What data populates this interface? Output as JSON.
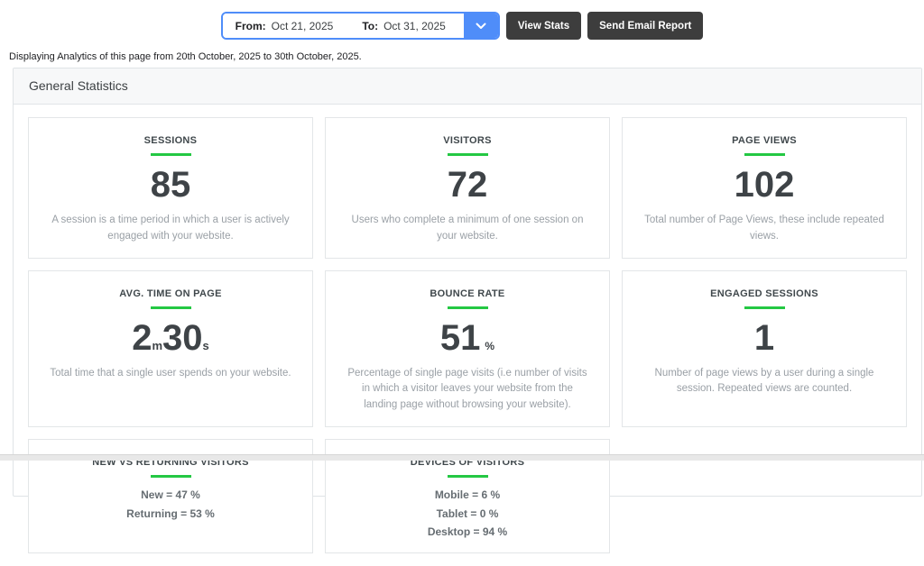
{
  "toolbar": {
    "from_label": "From:",
    "from_value": "Oct 21, 2025",
    "to_label": "To:",
    "to_value": "Oct 31, 2025",
    "view_stats_label": "View Stats",
    "send_email_label": "Send Email Report"
  },
  "subtitle": "Displaying Analytics of this page from 20th October, 2025 to 30th October, 2025.",
  "panel": {
    "title": "General Statistics"
  },
  "cards": [
    {
      "title": "SESSIONS",
      "value": "85",
      "description": "A session is a time period in which a user is actively engaged with your website."
    },
    {
      "title": "VISITORS",
      "value": "72",
      "description": "Users who complete a minimum of one session on your website."
    },
    {
      "title": "PAGE VIEWS",
      "value": "102",
      "description": "Total number of Page Views, these include repeated views."
    },
    {
      "title": "AVG. TIME ON PAGE",
      "value_main_1": "2",
      "value_unit_1": "m",
      "value_main_2": "30",
      "value_unit_2": "s",
      "description": "Total time that a single user spends on your website."
    },
    {
      "title": "BOUNCE RATE",
      "value": "51",
      "unit": "%",
      "description": "Percentage of single page visits (i.e number of visits in which a visitor leaves your website from the landing page without browsing your website)."
    },
    {
      "title": "ENGAGED SESSIONS",
      "value": "1",
      "description": "Number of page views by a user during a single session. Repeated views are counted."
    },
    {
      "title": "NEW VS RETURNING VISITORS",
      "lines": [
        "New = 47 %",
        "Returning = 53 %"
      ]
    },
    {
      "title": "DEVICES OF VISITORS",
      "lines": [
        "Mobile = 6 %",
        "Tablet = 0 %",
        "Desktop = 94 %"
      ]
    }
  ],
  "colors": {
    "accent_green": "#24c843",
    "accent_blue": "#4f8df9",
    "button_dark": "#3d3d3d"
  }
}
